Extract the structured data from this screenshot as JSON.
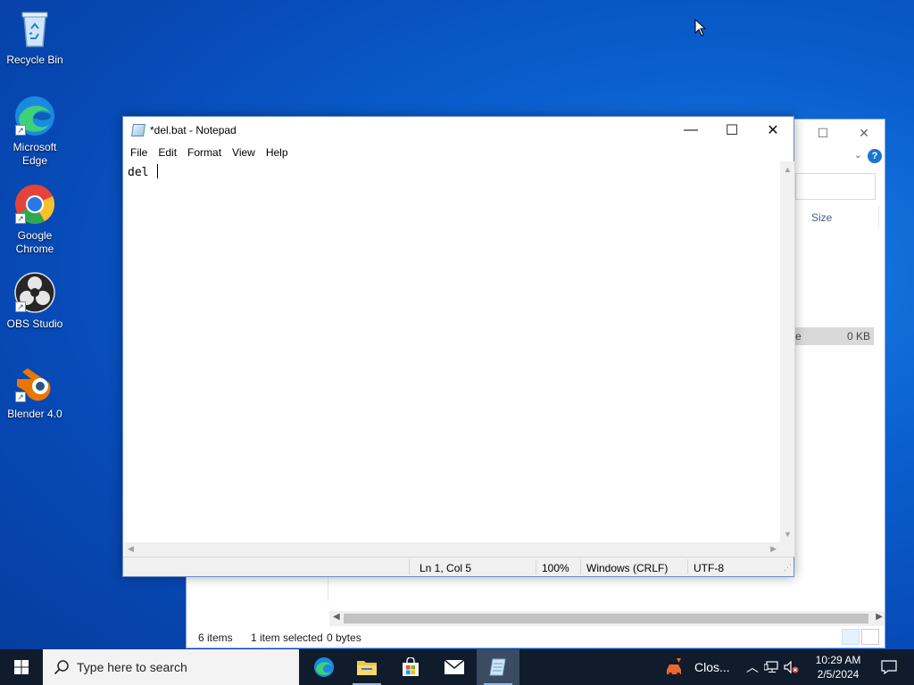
{
  "desktop": {
    "icons": [
      {
        "label": "Recycle Bin",
        "icon": "recycle-bin-icon"
      },
      {
        "label": "Microsoft Edge",
        "icon": "edge-icon"
      },
      {
        "label": "Google Chrome",
        "icon": "chrome-icon"
      },
      {
        "label": "OBS Studio",
        "icon": "obs-icon"
      },
      {
        "label": "Blender 4.0",
        "icon": "blender-icon"
      }
    ]
  },
  "explorer": {
    "column_size": "Size",
    "row_size": "0 KB",
    "row_name_fragment": "e",
    "status": {
      "items": "6 items",
      "selected": "1 item selected",
      "bytes": "0 bytes"
    }
  },
  "notepad": {
    "title": "*del.bat - Notepad",
    "menu": [
      "File",
      "Edit",
      "Format",
      "View",
      "Help"
    ],
    "content": "del ",
    "status": {
      "position": "Ln 1, Col 5",
      "zoom": "100%",
      "line_ending": "Windows (CRLF)",
      "encoding": "UTF-8"
    }
  },
  "taskbar": {
    "search_placeholder": "Type here to search",
    "close_label": "Clos...",
    "time": "10:29 AM",
    "date": "2/5/2024",
    "apps": [
      "edge-icon",
      "file-explorer-icon",
      "store-icon",
      "mail-icon",
      "notepad-icon"
    ]
  },
  "colors": {
    "taskbar": "#101b2c",
    "desktop_accent": "#0a5fcf",
    "selection": "#d9d9d9"
  }
}
